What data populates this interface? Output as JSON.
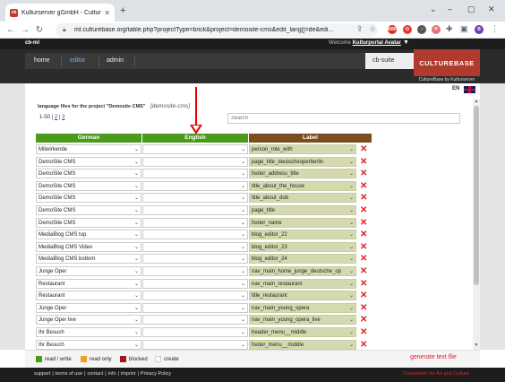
{
  "browser": {
    "tab_title": "Kulturserver gGmbH - Culturebas",
    "url": "ml.culturebase.org/table.php?projectType=brick&project=demosite-cms&edit_lang[]=de&edi...",
    "favicon_text": "cb"
  },
  "app": {
    "brand_short": "cb-ml",
    "welcome_prefix": "Welcome",
    "welcome_user": "Kulturportal Avatar",
    "nav": {
      "home": "home",
      "editor": "editor",
      "admin": "admin"
    },
    "suite": "cb-suite",
    "logo": "CULTUREBASE",
    "logo_sub": "CultureBase by Kulturserver",
    "language": "EN"
  },
  "panel": {
    "title": "language files for the project \"Demosite CMS\"",
    "project_id": "[demosite-cms]",
    "pager_range": "1-50",
    "pager_pages": [
      "2",
      "3"
    ],
    "search_placeholder": "Search"
  },
  "table": {
    "headers": {
      "german": "German",
      "english": "English",
      "label": "Label"
    },
    "rows": [
      {
        "de": "Mitwirkende",
        "en": "",
        "label": "person_role_with"
      },
      {
        "de": "DemoSite CMS",
        "en": "",
        "label": "page_title_deutscheoperberlin"
      },
      {
        "de": "DemoSite CMS",
        "en": "",
        "label": "footer_address_title"
      },
      {
        "de": "DemoSite CMS",
        "en": "",
        "label": "title_about_the_house"
      },
      {
        "de": "DemoSite CMS",
        "en": "",
        "label": "title_about_dob"
      },
      {
        "de": "DemoSite CMS",
        "en": "",
        "label": "page_title"
      },
      {
        "de": "DemoSite CMS",
        "en": "",
        "label": "footer_name"
      },
      {
        "de": "MediaBlog CMS top",
        "en": "",
        "label": "blog_editor_22"
      },
      {
        "de": "MediaBlog CMS Video",
        "en": "",
        "label": "blog_editor_23"
      },
      {
        "de": "MediaBlog CMS bottom",
        "en": "",
        "label": "blog_editor_24"
      },
      {
        "de": "Junge Oper",
        "en": "",
        "label": "nav_main_home_junge_deutsche_op"
      },
      {
        "de": "Restaurant",
        "en": "",
        "label": "nav_main_restaurant"
      },
      {
        "de": "Restaurant",
        "en": "",
        "label": "title_restaurant"
      },
      {
        "de": "Junge Oper",
        "en": "",
        "label": "nav_main_young_opera"
      },
      {
        "de": "Junge Oper live",
        "en": "",
        "label": "nav_main_young_opera_live"
      },
      {
        "de": "Ihr  Besuch",
        "en": "",
        "label": "header_menu__middle"
      },
      {
        "de": "Ihr  Besuch",
        "en": "",
        "label": "footer_menu__middle"
      }
    ]
  },
  "legend": {
    "read_write": "read / write",
    "read_only": "read only",
    "blocked": "blocked",
    "create": "create",
    "generate": "generate text file"
  },
  "footer": {
    "links": [
      "support",
      "terms of use",
      "contact",
      "info",
      "imprint",
      "Privacy Policy"
    ],
    "right": "Coenection for Art and Culture"
  },
  "colors": {
    "header_green": "#4a9b1c",
    "header_brown": "#7b4e1f",
    "label_bg": "#d4d9b0",
    "brand_red": "#b03a2e",
    "arrow_red": "#ee0000"
  },
  "icons": [
    "back-icon",
    "forward-icon",
    "reload-icon",
    "lock-icon",
    "share-icon",
    "star-icon",
    "chevron-down-icon",
    "delete-icon",
    "hamburger-icon",
    "flag-icon"
  ]
}
